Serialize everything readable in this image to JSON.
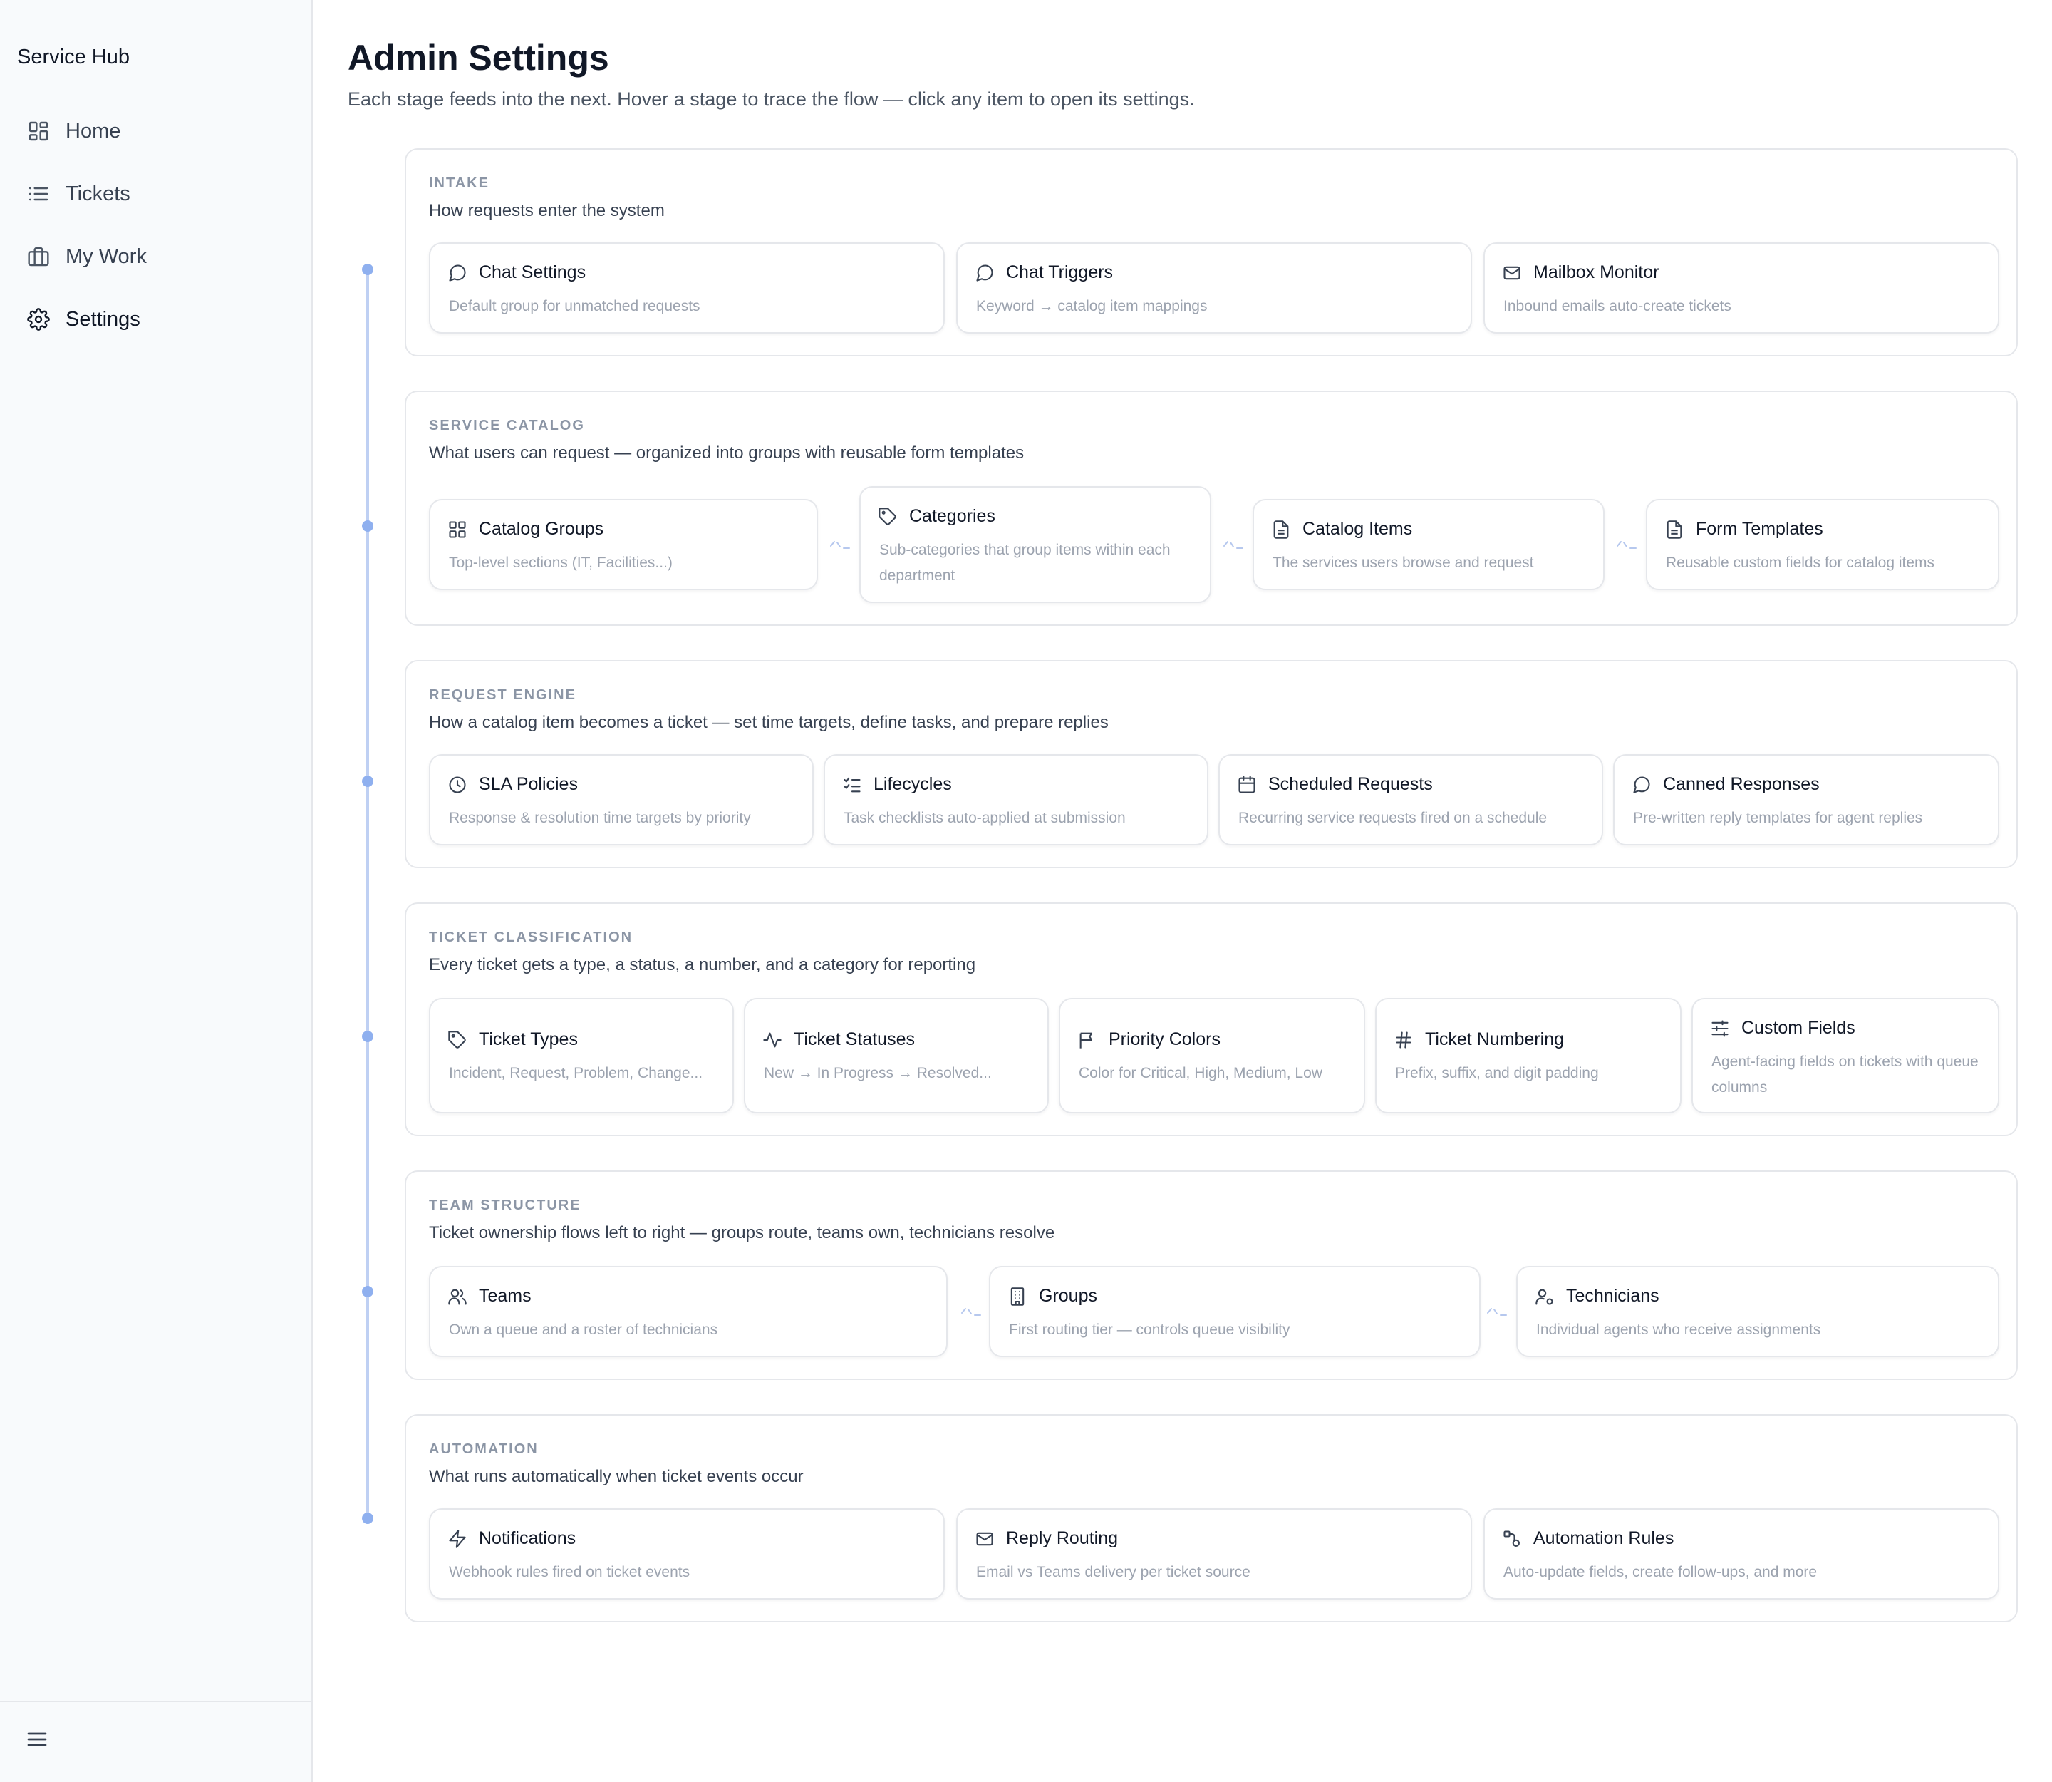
{
  "app": {
    "brand": "Service Hub"
  },
  "nav": {
    "items": [
      {
        "label": "Home",
        "icon": "grid-icon"
      },
      {
        "label": "Tickets",
        "icon": "list-icon"
      },
      {
        "label": "My Work",
        "icon": "briefcase-icon"
      },
      {
        "label": "Settings",
        "icon": "gear-icon"
      }
    ],
    "active": "Settings"
  },
  "page": {
    "title": "Admin Settings",
    "subtitle": "Each stage feeds into the next. Hover a stage to trace the flow — click any item to open its settings."
  },
  "stages": [
    {
      "label": "INTAKE",
      "description": "How requests enter the system",
      "items": [
        {
          "title": "Chat Settings",
          "description": "Default group for unmatched requests",
          "icon": "chat-icon"
        },
        {
          "title": "Chat Triggers",
          "description": "Keyword → catalog item mappings",
          "icon": "chat-icon"
        },
        {
          "title": "Mailbox Monitor",
          "description": "Inbound emails auto-create tickets",
          "icon": "mail-icon"
        }
      ]
    },
    {
      "label": "SERVICE CATALOG",
      "description": "What users can request — organized into groups with reusable form templates",
      "items": [
        {
          "title": "Catalog Groups",
          "description": "Top-level sections (IT, Facilities...)",
          "icon": "grid-icon"
        },
        {
          "title": "Categories",
          "description": "Sub-categories that group items within each department",
          "icon": "tag-icon"
        },
        {
          "title": "Catalog Items",
          "description": "The services users browse and request",
          "icon": "document-icon"
        },
        {
          "title": "Form Templates",
          "description": "Reusable custom fields for catalog items",
          "icon": "document-icon"
        }
      ]
    },
    {
      "label": "REQUEST ENGINE",
      "description": "How a catalog item becomes a ticket — set time targets, define tasks, and prepare replies",
      "items": [
        {
          "title": "SLA Policies",
          "description": "Response & resolution time targets by priority",
          "icon": "clock-icon"
        },
        {
          "title": "Lifecycles",
          "description": "Task checklists auto-applied at submission",
          "icon": "checklist-icon"
        },
        {
          "title": "Scheduled Requests",
          "description": "Recurring service requests fired on a schedule",
          "icon": "calendar-icon"
        },
        {
          "title": "Canned Responses",
          "description": "Pre-written reply templates for agent replies",
          "icon": "chat-icon"
        }
      ]
    },
    {
      "label": "TICKET CLASSIFICATION",
      "description": "Every ticket gets a type, a status, a number, and a category for reporting",
      "items": [
        {
          "title": "Ticket Types",
          "description": "Incident, Request, Problem, Change...",
          "icon": "tag-icon"
        },
        {
          "title": "Ticket Statuses",
          "description": "New → In Progress → Resolved...",
          "icon": "activity-icon"
        },
        {
          "title": "Priority Colors",
          "description": "Color for Critical, High, Medium, Low",
          "icon": "flag-icon"
        },
        {
          "title": "Ticket Numbering",
          "description": "Prefix, suffix, and digit padding",
          "icon": "hash-icon"
        },
        {
          "title": "Custom Fields",
          "description": "Agent-facing fields on tickets with queue columns",
          "icon": "sliders-icon"
        }
      ]
    },
    {
      "label": "TEAM STRUCTURE",
      "description": "Ticket ownership flows left to right — groups route, teams own, technicians resolve",
      "items": [
        {
          "title": "Teams",
          "description": "Own a queue and a roster of technicians",
          "icon": "users-icon"
        },
        {
          "title": "Groups",
          "description": "First routing tier — controls queue visibility",
          "icon": "building-icon"
        },
        {
          "title": "Technicians",
          "description": "Individual agents who receive assignments",
          "icon": "user-gear-icon"
        }
      ]
    },
    {
      "label": "AUTOMATION",
      "description": "What runs automatically when ticket events occur",
      "items": [
        {
          "title": "Notifications",
          "description": "Webhook rules fired on ticket events",
          "icon": "bolt-icon"
        },
        {
          "title": "Reply Routing",
          "description": "Email vs Teams delivery per ticket source",
          "icon": "mail-icon"
        },
        {
          "title": "Automation Rules",
          "description": "Auto-update fields, create follow-ups, and more",
          "icon": "workflow-icon"
        }
      ]
    }
  ],
  "colors": {
    "timeline": "#bfd0f3",
    "timeline_dot": "#8fb0ef",
    "border": "#e5e7eb",
    "muted_text": "#9ca3af",
    "label_text": "#8b95a5"
  }
}
